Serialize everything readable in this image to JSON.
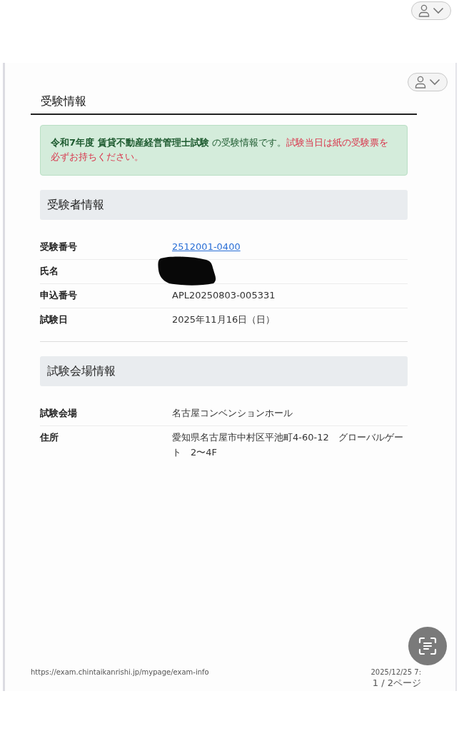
{
  "page_title": "受験情報",
  "notice": {
    "text": "**令和7年度 賃貸不動産経営管理士試験** の受験情報です。",
    "warning": "試験当日は紙の受験票を必ずお持ちください。"
  },
  "sections": [
    {
      "title": "受験者情報",
      "rows": [
        {
          "label": "受験番号",
          "value": "2512001-0400",
          "kind": "link"
        },
        {
          "label": "氏名",
          "kind": "redacted"
        },
        {
          "label": "申込番号",
          "value": "APL20250803-005331",
          "kind": "text"
        },
        {
          "label": "試験日",
          "value": "2025年11月16日（日）",
          "kind": "text"
        }
      ]
    },
    {
      "title": "試験会場情報",
      "rows": [
        {
          "label": "試験会場",
          "value": "名古屋コンベンションホール",
          "kind": "text"
        },
        {
          "label": "住所",
          "value": "愛知県名古屋市中村区平池町4-60-12　グローバルゲート　2〜4F",
          "kind": "text"
        }
      ]
    }
  ],
  "footer": {
    "url": "https://exam.chintaikanrishi.jp/mypage/exam-info",
    "date": "2025/12/25 7:",
    "page": "1 / 2ページ"
  }
}
